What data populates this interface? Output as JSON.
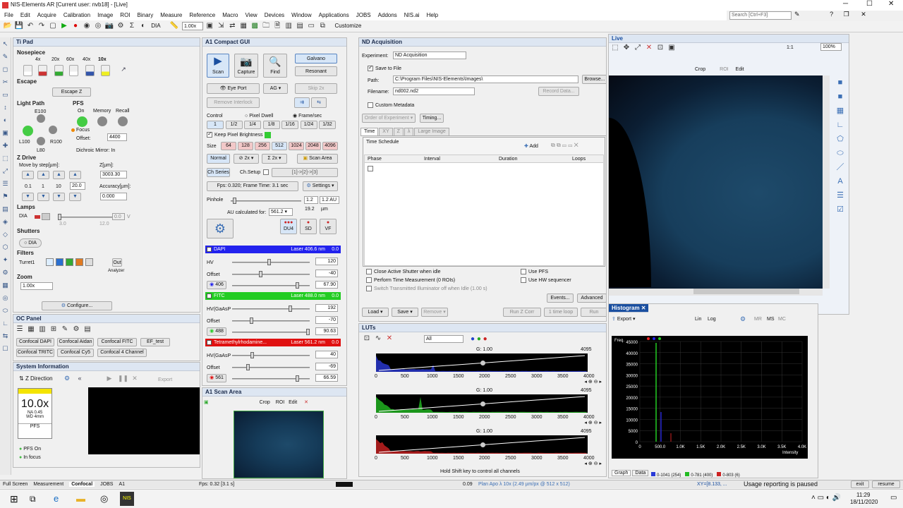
{
  "window": {
    "title": "NIS-Elements AR [Current user: nvb18] - [Live]",
    "search_placeholder": "Search [Ctrl+F3]"
  },
  "menu": [
    "File",
    "Edit",
    "Acquire",
    "Calibration",
    "Image",
    "ROI",
    "Binary",
    "Measure",
    "Reference",
    "Macro",
    "View",
    "Devices",
    "Window",
    "Applications",
    "JOBS",
    "Addons",
    "NIS.ai",
    "Help"
  ],
  "toolbar": {
    "zoom": "1.00x",
    "dia": "DIA",
    "customize": "Customize"
  },
  "tipad": {
    "title": "Ti Pad",
    "nosepiece": "Nosepiece",
    "objectives": [
      "4x",
      "20x",
      "60x",
      "40x",
      "10x"
    ],
    "escape": "Escape",
    "escape_z": "Escape Z",
    "light_path": "Light Path",
    "pfs": "PFS",
    "lp_e100": "E100",
    "lp_l100": "L100",
    "lp_r100": "R100",
    "lp_l80": "L80",
    "pfs_on": "On",
    "memory": "Memory",
    "recall": "Recall",
    "focus": "Focus",
    "offset_label": "Offset:",
    "offset_value": "4400",
    "dichroic": "Dichroic Mirror: In",
    "zdrive": "Z Drive",
    "move_by": "Move by step[µm]:",
    "z_label": "Z[µm]:",
    "z_value": "3003.30",
    "steps": [
      "0.1",
      "1",
      "10"
    ],
    "step_value": "20.0",
    "accuracy_label": "Accuracy[µm]:",
    "accuracy_value": "0.000",
    "lamps": "Lamps",
    "dia": "DIA",
    "lamp_min": "3.0",
    "lamp_max": "12.0",
    "lamp_value": "0.0",
    "lamp_unit": "V",
    "shutters": "Shutters",
    "dia_shutter": "DIA",
    "filters": "Filters",
    "turret": "Turret1",
    "out": "Out",
    "analyzer": "Analyzer",
    "zoom": "Zoom",
    "zoom_value": "1.00x",
    "configure": "Configure..."
  },
  "ocpanel": {
    "title": "OC Panel",
    "buttons": [
      "Confocal DAPI",
      "Confocal Aidan",
      "Confocal FITC",
      "EF_test",
      "Confocal TRITC",
      "Confocal Cy5",
      "Confocal 4 Channel"
    ]
  },
  "sysinfo": {
    "title": "System Information",
    "zdir": "Z Direction",
    "export": "Export",
    "objective": "10.0x",
    "na": "NA 0.45",
    "wd": "WD 4mm",
    "pfs": "PFS",
    "pfs_on": "PFS On",
    "in_focus": "In focus"
  },
  "a1": {
    "title": "A1 Compact GUI",
    "scan": "Scan",
    "capture": "Capture",
    "find": "Find",
    "galvano": "Galvano",
    "resonant": "Resonant",
    "eye_port": "Eye Port",
    "ag": "AG",
    "skip": "Skip 2x",
    "remove_interlock": "Remove Interlock",
    "control": "Control",
    "pixel_dwell": "Pixel Dwell",
    "frame_sec": "Frame/sec",
    "speeds": [
      "1",
      "1/2",
      "1/4",
      "1/8",
      "1/16",
      "1/24",
      "1/32"
    ],
    "keep_brightness": "Keep Pixel Brightness",
    "size": "Size",
    "sizes": [
      "64",
      "128",
      "256",
      "512",
      "1024",
      "2048",
      "4096"
    ],
    "normal": "Normal",
    "zoom2x": "2x",
    "sum2x": "2x",
    "scan_area": "Scan Area",
    "ch_series": "Ch Series",
    "ch_setup": "Ch.Setup",
    "ch_order": "[1]->[2]->[3]",
    "fps": "Fps: 0.320; Frame Time: 3.1 sec",
    "settings": "Settings",
    "pinhole": "Pinhole",
    "pinhole_value": "1.2",
    "pinhole_au": "1.2 AU",
    "pinhole_um": "19.2",
    "um": "µm",
    "au_calc": "AU calculated for:",
    "au_value": "561.2",
    "du4": "DU4",
    "sd": "SD",
    "vf": "VF",
    "channels": [
      {
        "name": "DAPI",
        "laser": "Laser 406.6 nm",
        "val": "0.0",
        "hv": "120",
        "offset": "-40",
        "laser_pow": "67.90",
        "tag": "406",
        "color": "#2222ee",
        "hv_label": "HV"
      },
      {
        "name": "FITC",
        "laser": "Laser 488.0 nm",
        "val": "0.0",
        "hv": "192",
        "offset": "-70",
        "laser_pow": "90.63",
        "tag": "488",
        "color": "#22cc22",
        "hv_label": "HV(GaAsP"
      },
      {
        "name": "Tetramethylrhodamine...",
        "laser": "Laser 561.2 nm",
        "val": "0.0",
        "hv": "40",
        "offset": "-69",
        "laser_pow": "66.59",
        "tag": "561",
        "color": "#e01010",
        "hv_label": "HV(GaAsP"
      }
    ],
    "offset_label": "Offset",
    "scan_area_title": "A1 Scan Area",
    "crop": "Crop",
    "roi": "ROI",
    "edit": "Edit"
  },
  "nd": {
    "title": "ND Acquisition",
    "experiment_label": "Experiment:",
    "experiment": "ND Acquisition",
    "save_to_file": "Save to File",
    "path_label": "Path:",
    "path": "C:\\Program Files\\NIS-Elements\\Images\\",
    "browse": "Browse...",
    "filename_label": "Filename:",
    "filename": "nd002.nd2",
    "record_data": "Record Data...",
    "custom_metadata": "Custom Metadata",
    "order": "Order of Experiment",
    "timing": "Timing...",
    "tabs": [
      "Time",
      "XY",
      "Z",
      "λ",
      "Large Image"
    ],
    "schedule": "Time Schedule",
    "add": "Add",
    "cols": [
      "Phase",
      "Interval",
      "Duration",
      "Loops"
    ],
    "close_shutter": "Close Active Shutter when idle",
    "use_pfs": "Use PFS",
    "perform_time": "Perform Time Measurement (0 ROIs)",
    "use_hw": "Use HW sequencer",
    "switch_trans": "Switch Transmitted Illuminator off when Idle (1.00 s)",
    "events": "Events...",
    "advanced": "Advanced",
    "load": "Load",
    "save": "Save",
    "remove": "Remove",
    "run_z": "Run Z Corr",
    "one_time": "1 time loop",
    "run": "Run"
  },
  "luts": {
    "title": "LUTs",
    "all": "All",
    "gamma": "G: 1.00",
    "ticks": [
      "0",
      "500",
      "1000",
      "1500",
      "2000",
      "2500",
      "3000",
      "3500",
      "4000"
    ],
    "max": "4095",
    "hint": "Hold Shift key to control all channels"
  },
  "live": {
    "title": "Live",
    "zoom": "100%",
    "ratio": "1:1",
    "crop": "Crop",
    "roi": "ROI",
    "edit": "Edit"
  },
  "histogram": {
    "title": "Histogram",
    "export": "Export",
    "lin": "Lin",
    "log": "Log",
    "mr": "MR",
    "ms": "MS",
    "mc": "MC",
    "freq": "Freq.",
    "yticks": [
      "45000",
      "40000",
      "35000",
      "30000",
      "25000",
      "20000",
      "15000",
      "10000",
      "5000",
      "0"
    ],
    "xticks": [
      "0",
      "500.0",
      "1.0K",
      "1.5K",
      "2.0K",
      "2.5K",
      "3.0K",
      "3.5K",
      "4.0K"
    ],
    "xlabel": "Intensity",
    "tabs": [
      "Graph",
      "Data"
    ],
    "legend": [
      "0-1041 (254)",
      "0-781 (400)",
      "0-803 (6)"
    ]
  },
  "status": {
    "tabs": [
      "Full Screen",
      "Measurement",
      "Confocal",
      "JOBS",
      "A1"
    ],
    "fps": "Fps: 0.32 [3.1 s]",
    "value": "0.09",
    "objective": "Plan Apo λ 10x (2.49 µm/px @ 512 x 512)",
    "xy": "XY=[8.133, ...",
    "usage": "Usage reporting is paused",
    "exit": "exit",
    "resume": "resume"
  },
  "taskbar": {
    "time": "11:29",
    "date": "18/11/2020"
  }
}
